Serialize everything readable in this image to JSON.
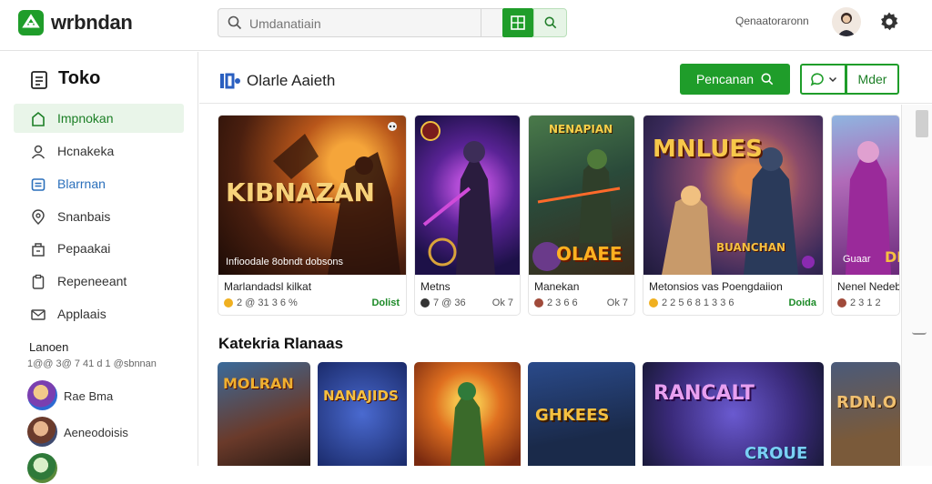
{
  "header": {
    "brand": "wrbndan",
    "search_placeholder": "Umdanatiain",
    "account_label": "Qenaatoraronn",
    "icons": {
      "logo": "play-logo-icon",
      "search": "search-icon",
      "grid": "grid-icon",
      "settings": "gear-icon"
    },
    "accent": "#1f9d2a"
  },
  "sidebar": {
    "title": "Toko",
    "items": [
      {
        "label": "Impnokan",
        "icon": "home-icon",
        "active": true
      },
      {
        "label": "Hcnakeka",
        "icon": "user-icon"
      },
      {
        "label": "Blarrnan",
        "icon": "cart-icon",
        "highlight": true
      },
      {
        "label": "Snanbais",
        "icon": "location-icon"
      },
      {
        "label": "Pepaakai",
        "icon": "store-icon"
      },
      {
        "label": "Repeneeant",
        "icon": "clipboard-icon"
      },
      {
        "label": "Applaais",
        "icon": "mail-icon"
      }
    ],
    "section_title": "Lanoen",
    "section_sub": "1@@ 3@ 7 41 d 1 @sbnnan",
    "friends": [
      {
        "name": "Rae Bma"
      },
      {
        "name": "Aeneodoisis"
      },
      {
        "name": ""
      }
    ]
  },
  "main": {
    "title": "Olarle Aaieth",
    "primary_button": "Pencanan",
    "more_button": "Mder",
    "section_title": "Katekria Rlanaas",
    "cards": [
      {
        "art_text": "KIBNAZAN",
        "caption": "Infioodale 8obndt dobsons",
        "title": "Marlandadsl kilkat",
        "meta": "2 @ 31 3 6 %",
        "tag": "Dolist",
        "tag_style": "green"
      },
      {
        "art_text": "",
        "caption": "",
        "title": "Metns",
        "meta": "7 @ 36",
        "tag": "Ok 7",
        "tag_style": "gray"
      },
      {
        "art_text": "OLAEE",
        "art_top": "NENAPIAN",
        "caption": "",
        "title": "Manekan",
        "meta": "2 3 6 6",
        "tag": "Ok 7",
        "tag_style": "gray"
      },
      {
        "art_text": "MNLUES",
        "art_sub": "BUANCHAN",
        "caption": "",
        "title": "Metonsios vas Poengdaiion",
        "meta": "2 2 5 6 8 1 3 3 6",
        "tag": "Doida",
        "tag_style": "green"
      },
      {
        "art_text": "DE",
        "caption": "Guaar",
        "title": "Nenel Nedeb",
        "meta": "2 3 1 2",
        "tag": "",
        "tag_style": "gray"
      }
    ],
    "tiles": [
      {
        "art_text": "MOLRAN"
      },
      {
        "art_text": "NANAJIDS"
      },
      {
        "art_text": ""
      },
      {
        "art_text": "GHKEES"
      },
      {
        "art_text": "RANCALT",
        "art_sub": "CROUE"
      },
      {
        "art_text": "RDN.O"
      }
    ]
  }
}
